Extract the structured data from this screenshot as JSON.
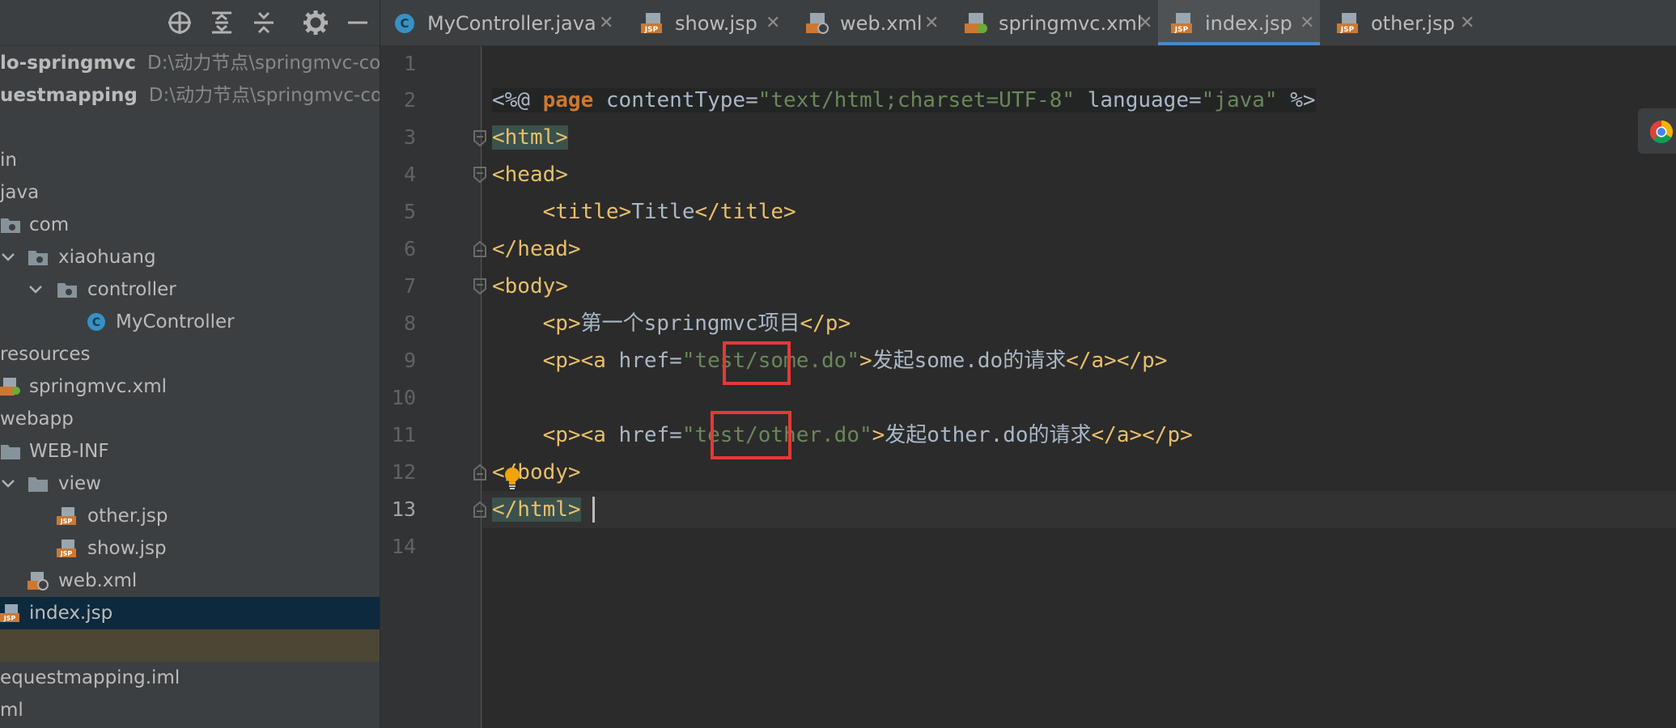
{
  "project_toolbar": {
    "icons": [
      "target-icon",
      "expand-all-icon",
      "collapse-all-icon",
      "gear-icon",
      "minimize-icon"
    ]
  },
  "tree": [
    {
      "label": "lo-springmvc",
      "path": "D:\\动力节点\\springmvc-cou",
      "bold": true
    },
    {
      "label": "uestmapping",
      "path": "D:\\动力节点\\springmvc-co",
      "bold": true
    },
    {
      "label": ""
    },
    {
      "label": "in"
    },
    {
      "label": "java"
    },
    {
      "label": "com",
      "icon": "folder-icon"
    },
    {
      "label": "xiaohuang",
      "icon": "folder-icon",
      "expanded": true
    },
    {
      "label": "controller",
      "icon": "folder-icon",
      "expanded": true
    },
    {
      "label": "MyController",
      "icon": "java-class-icon"
    },
    {
      "label": "resources"
    },
    {
      "label": "springmvc.xml",
      "icon": "spring-xml-icon"
    },
    {
      "label": "webapp"
    },
    {
      "label": "WEB-INF",
      "icon": "folder-icon"
    },
    {
      "label": "view",
      "icon": "folder-icon",
      "expanded": true
    },
    {
      "label": "other.jsp",
      "icon": "jsp-file-icon"
    },
    {
      "label": "show.jsp",
      "icon": "jsp-file-icon"
    },
    {
      "label": "web.xml",
      "icon": "web-xml-icon"
    },
    {
      "label": "index.jsp",
      "icon": "jsp-file-icon",
      "selected": true
    },
    {
      "label": ""
    },
    {
      "label": "equestmapping.iml"
    },
    {
      "label": "ml"
    }
  ],
  "tabs": [
    {
      "label": "MyController.java",
      "icon": "java-class-icon",
      "close": "✕"
    },
    {
      "label": "show.jsp",
      "icon": "jsp-file-icon",
      "close": "✕"
    },
    {
      "label": "web.xml",
      "icon": "web-xml-icon",
      "close": "✕"
    },
    {
      "label": "springmvc.xml",
      "icon": "spring-xml-icon",
      "close": "✕"
    },
    {
      "label": "index.jsp",
      "icon": "jsp-file-icon",
      "close": "✕",
      "active": true
    },
    {
      "label": "other.jsp",
      "icon": "jsp-file-icon",
      "close": "✕"
    }
  ],
  "line_numbers": [
    "1",
    "2",
    "3",
    "4",
    "5",
    "6",
    "7",
    "8",
    "9",
    "10",
    "11",
    "12",
    "13",
    "14"
  ],
  "current_line": "13",
  "code": {
    "l2": {
      "a": "<%@ ",
      "b": "page",
      "c": " contentType=",
      "d": "\"text/html;charset=UTF-8\"",
      "e": " language=",
      "f": "\"java\"",
      "g": " %>"
    },
    "l3": {
      "a": "<html>"
    },
    "l4": {
      "a": "<head>"
    },
    "l5": {
      "indent": "    ",
      "a": "<title>",
      "b": "Title",
      "c": "</title>"
    },
    "l6": {
      "a": "</head>"
    },
    "l7": {
      "a": "<body>"
    },
    "l8": {
      "indent": "    ",
      "a": "<p>",
      "b": "第一个springmvc项目",
      "c": "</p>"
    },
    "l9": {
      "indent": "    ",
      "a": "<p><a ",
      "b": "href=",
      "c": "\"test/some.do\"",
      "d": ">",
      "e": "发起some.do的请求",
      "f": "</a></p>"
    },
    "l11": {
      "indent": "    ",
      "a": "<p><a ",
      "b": "href=",
      "c": "\"test/other.do\"",
      "d": ">",
      "e": "发起other.do的请求",
      "f": "</a></p>"
    },
    "l12": {
      "a": "</body>"
    },
    "l13": {
      "a": "</html>"
    }
  },
  "colors": {
    "tag": "#e8bf6a",
    "string": "#6a8759",
    "keyword": "#cc7832",
    "text": "#a9b7c6",
    "selection": "#0d293e",
    "accent": "#4a88c7",
    "highlight_box": "#e53935"
  },
  "side_icons": [
    "chrome-icon",
    "lightbulb-icon"
  ]
}
